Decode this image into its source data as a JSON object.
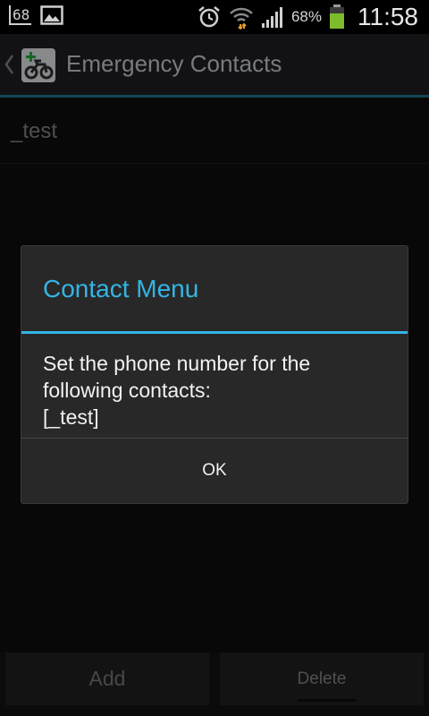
{
  "status_bar": {
    "notification_count": "68",
    "battery_percent": "68%",
    "time": "11:58",
    "icons": [
      "notification-count-icon",
      "image-icon",
      "alarm-icon",
      "wifi-icon",
      "signal-icon",
      "battery-icon"
    ],
    "battery_color": "#7dbb2c"
  },
  "action_bar": {
    "title": "Emergency Contacts",
    "back_icon": "chevron-left-icon",
    "app_icon": "motorcycle-plus-icon"
  },
  "list": {
    "items": [
      {
        "label": "_test"
      }
    ]
  },
  "dialog": {
    "title": "Contact Menu",
    "message_lines": [
      "Set the phone number for the",
      "following contacts:",
      "[_test]"
    ],
    "ok_label": "OK",
    "accent_color": "#33b5e5"
  },
  "buttons": {
    "add_label": "Add",
    "delete_label": "Delete"
  }
}
